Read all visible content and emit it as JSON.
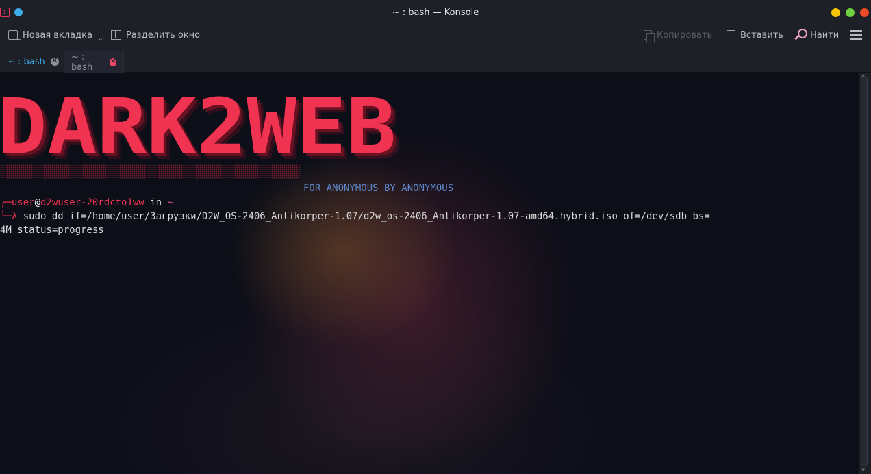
{
  "window": {
    "title": "~ : bash — Konsole"
  },
  "toolbar": {
    "new_tab_label": "Новая вкладка",
    "split_label": "Разделить окно",
    "copy_label": "Копировать",
    "paste_label": "Вставить",
    "find_label": "Найти"
  },
  "tabs": [
    {
      "label": "~ : bash"
    },
    {
      "label": "~ : bash"
    }
  ],
  "terminal": {
    "logo": "DARK2WEB",
    "tagline": "FOR ANONYMOUS BY ANONYMOUS",
    "prompt_corner_top": "╭─",
    "prompt_user": "user",
    "prompt_at": "@",
    "prompt_host": "d2wuser-20rdcto1ww",
    "prompt_in": " in ",
    "prompt_dir": "~",
    "prompt_corner_bottom": "╰─",
    "prompt_lambda": "λ",
    "command_line1": " sudo dd if=/home/user/Загрузки/D2W_OS-2406_Antikorper-1.07/d2w_os-2406_Antikorper-1.07-amd64.hybrid.iso of=/dev/sdb bs=",
    "command_line2": "4M status=progress"
  },
  "colors": {
    "accent_red": "#ef3350",
    "accent_blue": "#3daee9",
    "tagline_blue": "#5f86c8",
    "pink": "#e0508e"
  },
  "icons": [
    "terminal-app-icon",
    "new-tab-icon",
    "split-icon",
    "copy-icon",
    "paste-icon",
    "find-icon",
    "hamburger-menu-icon",
    "close-tab-icon"
  ]
}
